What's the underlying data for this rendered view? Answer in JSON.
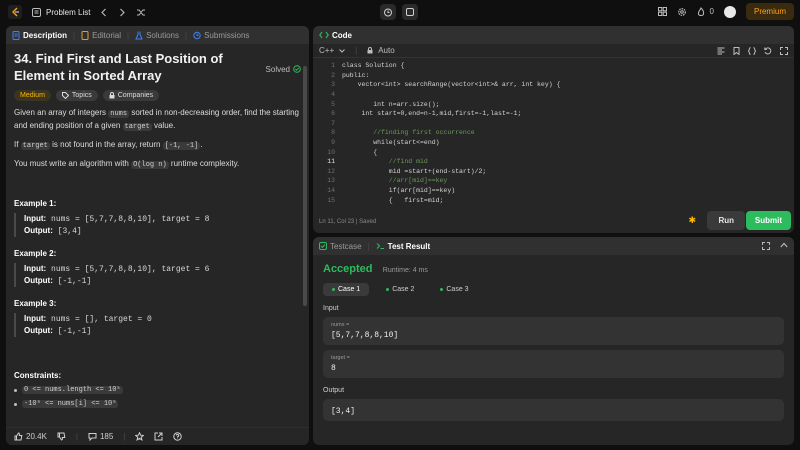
{
  "topbar": {
    "problem_list": "Problem List",
    "streak": "0",
    "premium": "Premium"
  },
  "desc_tabs": [
    "Description",
    "Editorial",
    "Solutions",
    "Submissions"
  ],
  "problem": {
    "title": "34. Find First and Last Position of Element in Sorted Array",
    "solved": "Solved",
    "difficulty": "Medium",
    "topics": "Topics",
    "companies": "Companies",
    "p1a": "Given an array of integers ",
    "p1_code1": "nums",
    "p1b": " sorted in non-decreasing order, find the starting and ending position of a given ",
    "p1_code2": "target",
    "p1c": " value.",
    "p2a": "If ",
    "p2_code1": "target",
    "p2b": " is not found in the array, return ",
    "p2_code2": "[-1, -1]",
    "p2c": ".",
    "p3a": "You must write an algorithm with ",
    "p3_code": "O(log n)",
    "p3b": " runtime complexity.",
    "examples": [
      {
        "title": "Example 1:",
        "input_label": "Input:",
        "input": " nums = [5,7,7,8,8,10], target = 8",
        "output_label": "Output:",
        "output": " [3,4]"
      },
      {
        "title": "Example 2:",
        "input_label": "Input:",
        "input": " nums = [5,7,7,8,8,10], target = 6",
        "output_label": "Output:",
        "output": " [-1,-1]"
      },
      {
        "title": "Example 3:",
        "input_label": "Input:",
        "input": " nums = [], target = 0",
        "output_label": "Output:",
        "output": " [-1,-1]"
      }
    ],
    "constraints_title": "Constraints:",
    "constraints": [
      "0 <= nums.length <= 10⁵",
      "-10⁹ <= nums[i] <= 10⁹"
    ]
  },
  "desc_footer": {
    "likes": "20.4K",
    "comments": "185"
  },
  "code_panel": {
    "tab": "Code",
    "language": "C++",
    "mode": "Auto",
    "status": "Ln 11, Col 23  |  Saved",
    "run": "Run",
    "submit": "Submit",
    "lines": [
      {
        "n": "1",
        "t": "class Solution {"
      },
      {
        "n": "2",
        "t": "public:"
      },
      {
        "n": "3",
        "t": "    vector<int> searchRange(vector<int>& arr, int key) {"
      },
      {
        "n": "4",
        "t": ""
      },
      {
        "n": "5",
        "t": "        int n=arr.size();"
      },
      {
        "n": "6",
        "t": "     int start=0,end=n-1,mid,first=-1,last=-1;"
      },
      {
        "n": "7",
        "t": ""
      },
      {
        "n": "8",
        "t": "        //finding first occurrence"
      },
      {
        "n": "9",
        "t": "        while(start<=end)"
      },
      {
        "n": "10",
        "t": "        {"
      },
      {
        "n": "11",
        "t": "            //find mid"
      },
      {
        "n": "12",
        "t": "            mid =start+(end-start)/2;"
      },
      {
        "n": "13",
        "t": "            //arr[mid]==key"
      },
      {
        "n": "14",
        "t": "            if(arr[mid]==key)"
      },
      {
        "n": "15",
        "t": "            {   first=mid;"
      }
    ]
  },
  "result_panel": {
    "tab_testcase": "Testcase",
    "tab_result": "Test Result",
    "status": "Accepted",
    "runtime": "Runtime: 4 ms",
    "cases": [
      "Case 1",
      "Case 2",
      "Case 3"
    ],
    "input_label": "Input",
    "nums_label": "nums =",
    "nums_value": "[5,7,7,8,8,10]",
    "target_label": "target =",
    "target_value": "8",
    "output_label": "Output",
    "output_value": "[3,4]"
  },
  "colors": {
    "accent_green": "#2cbb5d",
    "medium_yellow": "#ffb800",
    "premium_orange": "#ffa116",
    "breakpoint_red": "#e05d5d"
  }
}
